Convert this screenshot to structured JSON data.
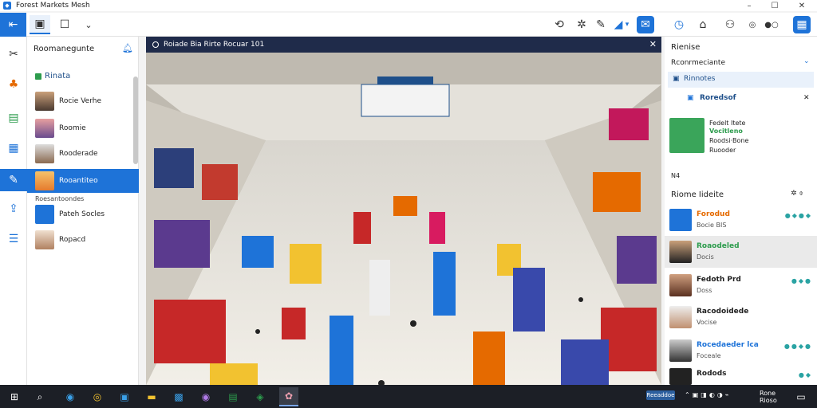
{
  "window": {
    "title": "Forest Markets Mesh"
  },
  "panel": {
    "header": "Roomanegunte",
    "group_label": "Rinata",
    "contacts": [
      {
        "name": "Rocie Verhe",
        "selected": false
      },
      {
        "name": "Roomie",
        "selected": false
      },
      {
        "name": "Rooderade",
        "selected": false
      },
      {
        "name": "Rooantiteo",
        "selected": true
      },
      {
        "name": "Pateh Socles",
        "selected": false
      },
      {
        "name": "Ropacd",
        "selected": false
      }
    ],
    "sub_label": "Roesantoondes"
  },
  "viewer": {
    "caption": "Roiade Bia Rirte Rocuar 101"
  },
  "right": {
    "title": "Rienise",
    "subtitle": "Rconrmeciante",
    "section": "Rinnotes",
    "pinned_title": "Roredsof",
    "card_line1": "Fedelt Itete",
    "card_line2": "Vocitleno",
    "card_line3": "Roodsi·Bone",
    "card_line4": "Ruooder",
    "counter": "N4",
    "list_title": "Riome Iideite",
    "list": [
      {
        "name": "Forodud",
        "sub": "Bocie BIS",
        "name_color": "#e56a00",
        "selected": false
      },
      {
        "name": "Roaodeled",
        "sub": "Docis",
        "name_color": "#2d9c4d",
        "selected": true
      },
      {
        "name": "Fedoth Prd",
        "sub": "Doss",
        "name_color": "#222222",
        "selected": false
      },
      {
        "name": "Racodoidede",
        "sub": "Vocise",
        "name_color": "#222222",
        "selected": false
      },
      {
        "name": "Rocedaeder lca",
        "sub": "Foceale",
        "name_color": "#1e73d8",
        "selected": false
      },
      {
        "name": "Rodods",
        "sub": "",
        "name_color": "#222222",
        "selected": false
      }
    ]
  },
  "taskbar": {
    "badge": "Reeaddoe",
    "time": "Rone Rioso"
  },
  "colors": {
    "accent": "#1e73d8",
    "taskbar": "#1c1f26",
    "viewer_bar": "#1f2b4a"
  }
}
